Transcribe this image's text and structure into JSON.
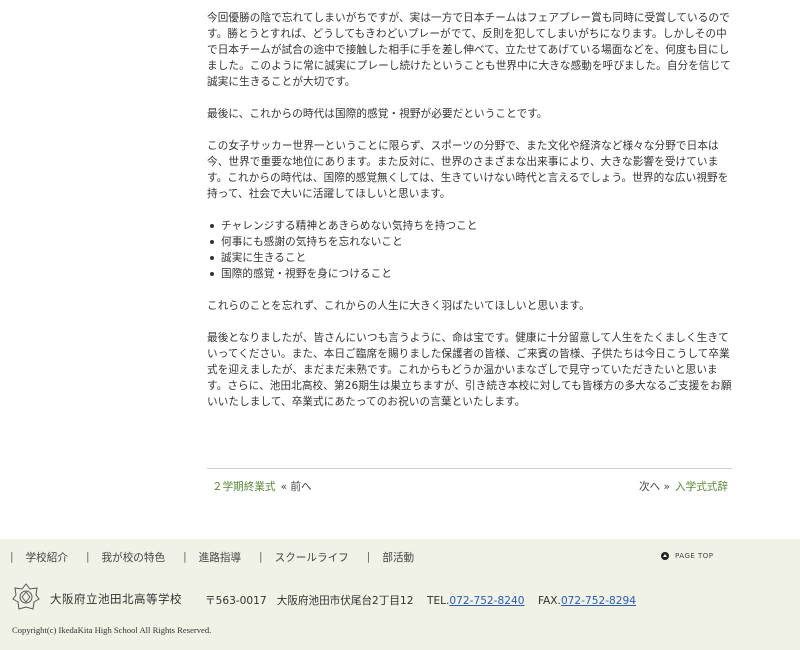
{
  "article": {
    "p1": "今回優勝の陰で忘れてしまいがちですが、実は一方で日本チームはフェアプレー賞も同時に受賞しているのです。勝とうとすれば、どうしてもきわどいプレーがでて、反則を犯してしまいがちになります。しかしその中で日本チームが試合の途中で接触した相手に手を差し伸べて、立たせてあげている場面などを、何度も目にしました。このように常に誠実にプレーし続けたということも世界中に大きな感動を呼びました。自分を信じて誠実に生きることが大切です。",
    "p2": "最後に、これからの時代は国際的感覚・視野が必要だということです。",
    "p3": "この女子サッカー世界一ということに限らず、スポーツの分野で、また文化や経済など様々な分野で日本は今、世界で重要な地位にあります。また反対に、世界のさまざまな出来事により、大きな影響を受けています。これからの時代は、国際的感覚無くしては、生きていけない時代と言えるでしょう。世界的な広い視野を持って、社会で大いに活躍してほしいと思います。",
    "bullets": [
      "チャレンジする精神とあきらめない気持ちを持つこと",
      "何事にも感謝の気持ちを忘れないこと",
      "誠実に生きること",
      "国際的感覚・視野を身につけること"
    ],
    "p4": "これらのことを忘れず、これからの人生に大きく羽ばたいてほしいと思います。",
    "p5": "最後となりましたが、皆さんにいつも言うように、命は宝です。健康に十分留意して人生をたくましく生きていってください。また、本日ご臨席を賜りました保護者の皆様、ご来賓の皆様、子供たちは今日こうして卒業式を迎えましたが、まだまだ未熟です。これからもどうか温かいまなざしで見守っていただきたいと思います。さらに、池田北高校、第26期生は巣立ちますが、引き続き本校に対しても皆様方の多大なるご支援をお願いいたしまして、卒業式にあたってのお祝いの言葉といたします。"
  },
  "postnav": {
    "prev_title": "２学期終業式",
    "prev_label": "« 前へ",
    "next_label": "次へ »",
    "next_title": "入学式式辞"
  },
  "footer": {
    "nav": [
      "学校紹介",
      "我が校の特色",
      "進路指導",
      "スクールライフ",
      "部活動"
    ],
    "separator": "|",
    "page_top": "PAGE TOP",
    "school_name": "大阪府立池田北高等学校",
    "postal": "〒563-0017",
    "address": "大阪府池田市伏尾台2丁目12",
    "tel_label": "TEL.",
    "tel": "072-752-8240",
    "fax_label": "FAX.",
    "fax": "072-752-8294",
    "copyright": "Copyright(c) IkedaKita High School All Rights Reserved."
  },
  "colors": {
    "link_green": "#5b8a3a",
    "link_blue": "#2c5db0",
    "footer_bg": "#f0f2e6"
  },
  "icons": {
    "page_top": "circle-up-arrow-icon",
    "logo": "school-crest-icon"
  }
}
